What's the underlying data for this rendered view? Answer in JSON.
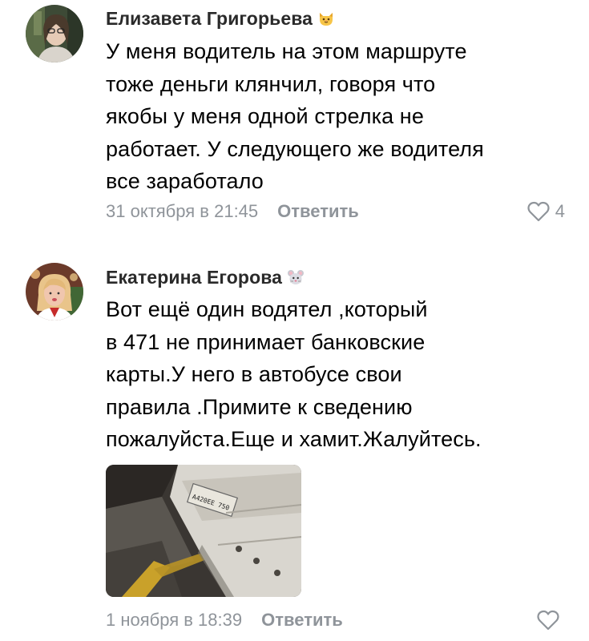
{
  "comments": [
    {
      "author": "Елизавета Григорьева",
      "emoji": "cat-face-icon",
      "text": "У меня водитель на этом маршруте\nтоже деньги клянчил, говоря что\nякобы у меня одной стрелка не\nработает. У следующего же водителя\nвсе заработало",
      "date": "31 октября в 21:45",
      "reply_label": "Ответить",
      "like_icon": "heart-outline-icon",
      "likes": "4"
    },
    {
      "author": "Екатерина Егорова",
      "emoji": "mouse-face-icon",
      "text": "Вот ещё один водятел ,который\nв 471 не принимает банковские\nкарты.У него в автобусе свои\nправила .Примите к сведению\nпожалуйста.Еще и хамит.Жалуйтесь.",
      "attachment_icon": "photo-attachment",
      "date": "1 ноября в 18:39",
      "reply_label": "Ответить",
      "like_icon": "heart-outline-icon"
    }
  ],
  "colors": {
    "author": "#2a2a2a",
    "text": "#000000",
    "meta": "#8f949a",
    "background": "#ffffff"
  }
}
